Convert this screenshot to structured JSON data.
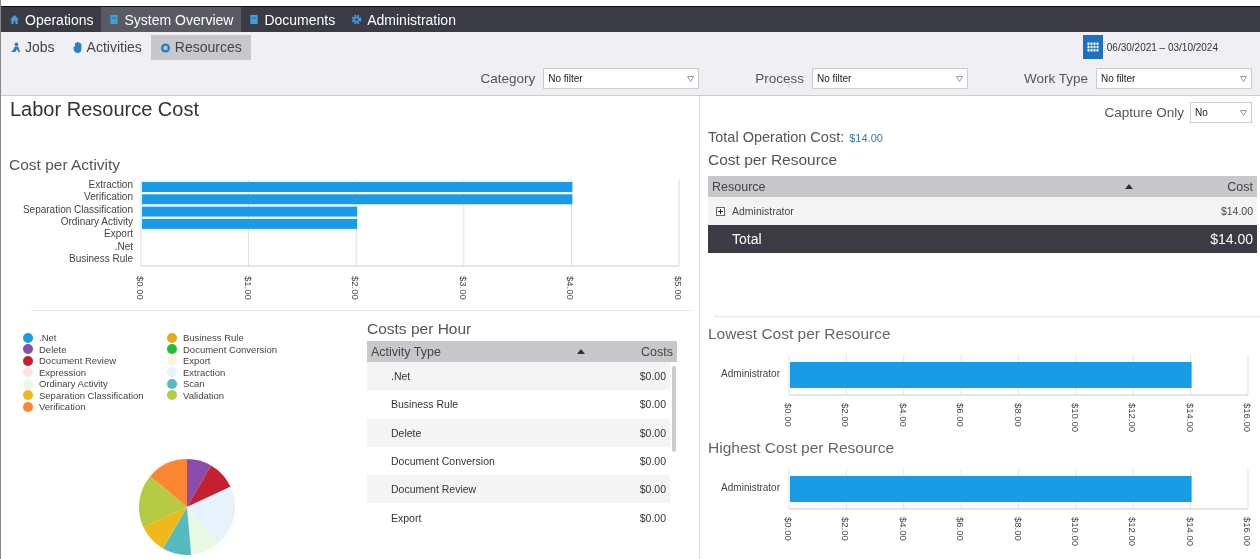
{
  "nav": {
    "tabs": [
      {
        "label": "Operations",
        "selected": false
      },
      {
        "label": "System Overview",
        "selected": true
      },
      {
        "label": "Documents",
        "selected": false
      },
      {
        "label": "Administration",
        "selected": false
      }
    ]
  },
  "subnav": {
    "tabs": [
      {
        "label": "Jobs",
        "selected": false
      },
      {
        "label": "Activities",
        "selected": false
      },
      {
        "label": "Resources",
        "selected": true
      }
    ],
    "date_range": "06/30/2021 – 03/10/2024"
  },
  "filters": [
    {
      "label": "Category",
      "value": "No filter"
    },
    {
      "label": "Process",
      "value": "No filter"
    },
    {
      "label": "Work Type",
      "value": "No filter"
    }
  ],
  "page_title": "Labor Resource Cost",
  "capture_only": {
    "label": "Capture Only",
    "value": "No"
  },
  "cost_per_activity": {
    "title": "Cost per Activity",
    "chart_data": {
      "type": "bar",
      "orientation": "horizontal",
      "categories": [
        "Extraction",
        "Verification",
        "Separation Classification",
        "Ordinary Activity",
        "Export",
        ".Net",
        "Business Rule"
      ],
      "series": [
        {
          "color": "#1a9be6",
          "values": [
            4,
            4,
            2,
            2,
            0,
            0,
            0
          ]
        }
      ],
      "grid": true,
      "xlim": [
        0,
        5
      ],
      "xticks": [
        {
          "value": 0,
          "label": "$0.00"
        },
        {
          "value": 1,
          "label": "$1.00"
        },
        {
          "value": 2,
          "label": "$2.00"
        },
        {
          "value": 3,
          "label": "$3.00"
        },
        {
          "value": 4,
          "label": "$4.00"
        },
        {
          "value": 5,
          "label": "$5.00"
        }
      ]
    }
  },
  "legend": [
    {
      "label": ".Net",
      "color": "#1a9be6"
    },
    {
      "label": "Business Rule",
      "color": "#e8a81a"
    },
    {
      "label": "Delete",
      "color": "#8a4baa"
    },
    {
      "label": "Document Conversion",
      "color": "#1fbf2f"
    },
    {
      "label": "Document Review",
      "color": "#c4202f"
    },
    {
      "label": "Export",
      "color": "#fdf3df"
    },
    {
      "label": "Expression",
      "color": "#fde3e6"
    },
    {
      "label": "Extraction",
      "color": "#e6f3fd"
    },
    {
      "label": "Ordinary Activity",
      "color": "#e8fbe2"
    },
    {
      "label": "Scan",
      "color": "#54bcc0"
    },
    {
      "label": "Separation Classification",
      "color": "#f0b91a"
    },
    {
      "label": "Validation",
      "color": "#b4cb42"
    },
    {
      "label": "Verification",
      "color": "#fb8531"
    }
  ],
  "costs_per_hour": {
    "title": "Costs per Hour",
    "columns": [
      "Activity Type",
      "Costs"
    ],
    "rows": [
      {
        "activity": ".Net",
        "cost": "$0.00"
      },
      {
        "activity": "Business Rule",
        "cost": "$0.00"
      },
      {
        "activity": "Delete",
        "cost": "$0.00"
      },
      {
        "activity": "Document Conversion",
        "cost": "$0.00"
      },
      {
        "activity": "Document Review",
        "cost": "$0.00"
      },
      {
        "activity": "Export",
        "cost": "$0.00"
      }
    ]
  },
  "total_operation_cost": {
    "label": "Total Operation Cost:",
    "value": "$14.00"
  },
  "cost_per_resource": {
    "title": "Cost per Resource",
    "columns": [
      "Resource",
      "Cost"
    ],
    "rows": [
      {
        "resource": "Administrator",
        "cost": "$14.00",
        "expanded": false
      }
    ],
    "total": {
      "label": "Total",
      "value": "$14.00"
    }
  },
  "resource_charts": [
    {
      "title": "Lowest Cost per Resource",
      "chart_data": {
        "type": "bar",
        "orientation": "horizontal",
        "categories": [
          "Administrator"
        ],
        "series": [
          {
            "color": "#1a9be6",
            "values": [
              14
            ]
          }
        ],
        "grid": true,
        "xlim": [
          0,
          16
        ],
        "xticks": [
          {
            "value": 0,
            "label": "$0.00"
          },
          {
            "value": 2,
            "label": "$2.00"
          },
          {
            "value": 4,
            "label": "$4.00"
          },
          {
            "value": 6,
            "label": "$6.00"
          },
          {
            "value": 8,
            "label": "$8.00"
          },
          {
            "value": 10,
            "label": "$10.00"
          },
          {
            "value": 12,
            "label": "$12.00"
          },
          {
            "value": 14,
            "label": "$14.00"
          },
          {
            "value": 16,
            "label": "$16.00"
          }
        ]
      }
    },
    {
      "title": "Highest Cost per Resource",
      "chart_data": {
        "type": "bar",
        "orientation": "horizontal",
        "categories": [
          "Administrator"
        ],
        "series": [
          {
            "color": "#1a9be6",
            "values": [
              14
            ]
          }
        ],
        "grid": true,
        "xlim": [
          0,
          16
        ],
        "xticks": [
          {
            "value": 0,
            "label": "$0.00"
          },
          {
            "value": 2,
            "label": "$2.00"
          },
          {
            "value": 4,
            "label": "$4.00"
          },
          {
            "value": 6,
            "label": "$6.00"
          },
          {
            "value": 8,
            "label": "$8.00"
          },
          {
            "value": 10,
            "label": "$10.00"
          },
          {
            "value": 12,
            "label": "$12.00"
          },
          {
            "value": 14,
            "label": "$14.00"
          },
          {
            "value": 16,
            "label": "$16.00"
          }
        ]
      }
    }
  ]
}
